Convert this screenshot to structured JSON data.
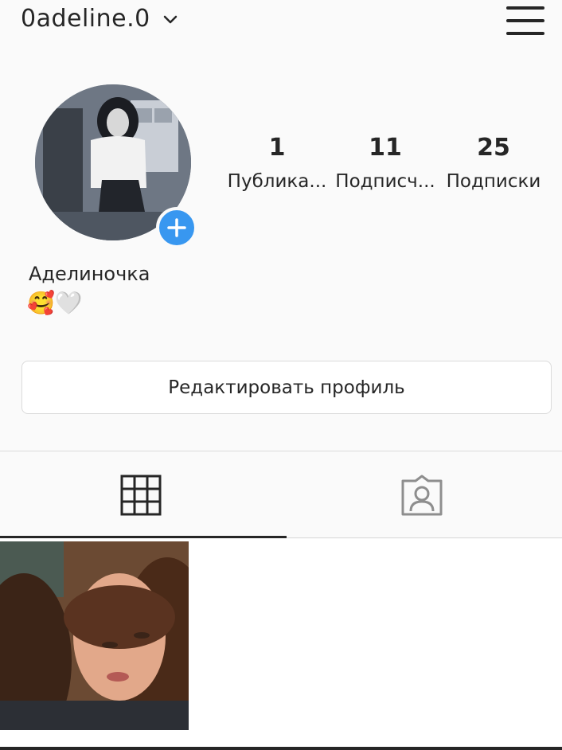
{
  "header": {
    "username": "0adeline.0"
  },
  "profile": {
    "full_name": "Аделиночка",
    "bio": "🥰🤍",
    "stats": [
      {
        "value": "1",
        "label": "Публика..."
      },
      {
        "value": "11",
        "label": "Подписч..."
      },
      {
        "value": "25",
        "label": "Подписки"
      }
    ],
    "edit_button_label": "Редактировать профиль"
  },
  "colors": {
    "accent": "#3897f0",
    "text": "#262626",
    "border": "#dbdbdb",
    "background": "#fafafa"
  },
  "icons": {
    "menu": "hamburger-icon",
    "dropdown": "chevron-down-icon",
    "add": "plus-icon",
    "grid_tab": "grid-icon",
    "tagged_tab": "tagged-person-icon"
  }
}
